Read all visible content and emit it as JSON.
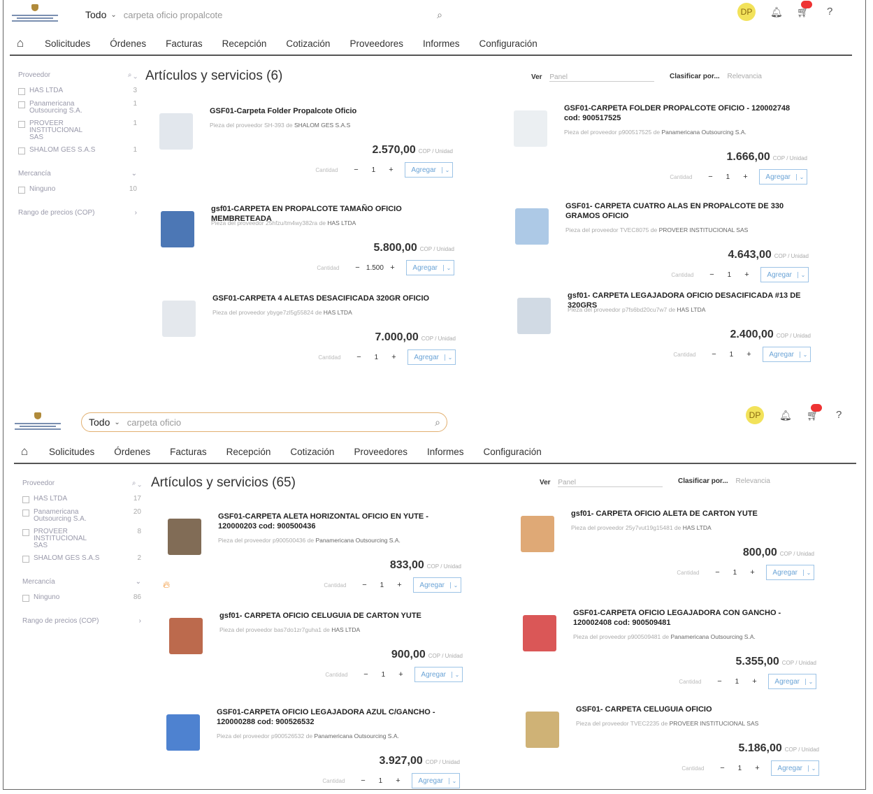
{
  "screens": [
    {
      "search": {
        "scope": "Todo",
        "query": "carpeta oficio propalcote"
      },
      "user": {
        "initials": "DP"
      },
      "nav": [
        "Solicitudes",
        "Órdenes",
        "Facturas",
        "Recepción",
        "Cotización",
        "Proveedores",
        "Informes",
        "Configuración"
      ],
      "results_title": "Artículos y servicios (6)",
      "view": {
        "label": "Ver",
        "value": "Panel"
      },
      "sort": {
        "label": "Clasificar por...",
        "value": "Relevancia"
      },
      "facets": {
        "provider_title": "Proveedor",
        "providers": [
          {
            "name": "HAS LTDA",
            "count": "3"
          },
          {
            "name": "Panamericana Outsourcing S.A.",
            "count": "1"
          },
          {
            "name": "PROVEER INSTITUCIONAL SAS",
            "count": "1"
          },
          {
            "name": "SHALOM GES S.A.S",
            "count": "1"
          }
        ],
        "merch_title": "Mercancía",
        "merch": [
          {
            "name": "Ninguno",
            "count": "10"
          }
        ],
        "price_title": "Rango de precios (COP)"
      },
      "products": [
        {
          "title": "GSF01-Carpeta Folder Propalcote Oficio",
          "sup_prefix": "Pieza del proveedor SH-393 de",
          "supplier": "SHALOM GES S.A.S",
          "price": "2.570,00",
          "unit": "COP / Unidad",
          "qty": "1"
        },
        {
          "title": "GSF01-CARPETA FOLDER PROPALCOTE OFICIO - 120002748 cod: 900517525",
          "sup_prefix": "Pieza del proveedor p900517525 de",
          "supplier": "Panamericana Outsourcing S.A.",
          "price": "1.666,00",
          "unit": "COP / Unidad",
          "qty": "1"
        },
        {
          "title": "gsf01-CARPETA EN PROPALCOTE TAMAÑO OFICIO MEMBRETEADA",
          "sup_prefix": "Pieza del proveedor 25hfzu/tm4wy382ra de",
          "supplier": "HAS LTDA",
          "price": "5.800,00",
          "unit": "COP / Unidad",
          "qty": "1.500"
        },
        {
          "title": "GSF01- CARPETA CUATRO ALAS EN PROPALCOTE DE 330 GRAMOS OFICIO",
          "sup_prefix": "Pieza del proveedor TVEC8075 de",
          "supplier": "PROVEER INSTITUCIONAL SAS",
          "price": "4.643,00",
          "unit": "COP / Unidad",
          "qty": "1"
        },
        {
          "title": "GSF01-CARPETA 4 ALETAS DESACIFICADA 320GR OFICIO",
          "sup_prefix": "Pieza del proveedor ybyge7zl5g55824 de",
          "supplier": "HAS LTDA",
          "price": "7.000,00",
          "unit": "COP / Unidad",
          "qty": "1"
        },
        {
          "title": "gsf01- CARPETA LEGAJADORA OFICIO DESACIFICADA #13 DE 320GRS",
          "sup_prefix": "Pieza del proveedor p7fs6bd20cu7w7 de",
          "supplier": "HAS LTDA",
          "price": "2.400,00",
          "unit": "COP / Unidad",
          "qty": "1"
        }
      ]
    },
    {
      "search": {
        "scope": "Todo",
        "query": "carpeta oficio"
      },
      "user": {
        "initials": "DP"
      },
      "nav": [
        "Solicitudes",
        "Órdenes",
        "Facturas",
        "Recepción",
        "Cotización",
        "Proveedores",
        "Informes",
        "Configuración"
      ],
      "results_title": "Artículos y servicios (65)",
      "view": {
        "label": "Ver",
        "value": "Panel"
      },
      "sort": {
        "label": "Clasificar por...",
        "value": "Relevancia"
      },
      "facets": {
        "provider_title": "Proveedor",
        "providers": [
          {
            "name": "HAS LTDA",
            "count": "17"
          },
          {
            "name": "Panamericana Outsourcing S.A.",
            "count": "20"
          },
          {
            "name": "PROVEER INSTITUCIONAL SAS",
            "count": "8"
          },
          {
            "name": "SHALOM GES S.A.S",
            "count": "2"
          }
        ],
        "merch_title": "Mercancía",
        "merch": [
          {
            "name": "Ninguno",
            "count": "86"
          }
        ],
        "price_title": "Rango de precios (COP)"
      },
      "products": [
        {
          "title": "GSF01-CARPETA ALETA HORIZONTAL OFICIO EN YUTE - 120000203 cod: 900500436",
          "sup_prefix": "Pieza del proveedor p900500436 de",
          "supplier": "Panamericana Outsourcing S.A.",
          "price": "833,00",
          "unit": "COP / Unidad",
          "qty": "1"
        },
        {
          "title": "gsf01- CARPETA OFICIO ALETA DE CARTON YUTE",
          "sup_prefix": "Pieza del proveedor 25y7vut19g15481 de",
          "supplier": "HAS LTDA",
          "price": "800,00",
          "unit": "COP / Unidad",
          "qty": "1"
        },
        {
          "title": "gsf01- CARPETA OFICIO CELUGUIA DE CARTON YUTE",
          "sup_prefix": "Pieza del proveedor bas7do1zr7guha1 de",
          "supplier": "HAS LTDA",
          "price": "900,00",
          "unit": "COP / Unidad",
          "qty": "1"
        },
        {
          "title": "GSF01-CARPETA OFICIO LEGAJADORA CON GANCHO - 120002408 cod: 900509481",
          "sup_prefix": "Pieza del proveedor p900509481 de",
          "supplier": "Panamericana Outsourcing S.A.",
          "price": "5.355,00",
          "unit": "COP / Unidad",
          "qty": "1"
        },
        {
          "title": "GSF01-CARPETA OFICIO LEGAJADORA AZUL C/GANCHO - 120000288 cod: 900526532",
          "sup_prefix": "Pieza del proveedor p900526532 de",
          "supplier": "Panamericana Outsourcing S.A.",
          "price": "3.927,00",
          "unit": "COP / Unidad",
          "qty": "1"
        },
        {
          "title": "GSF01- CARPETA CELUGUIA OFICIO",
          "sup_prefix": "Pieza del proveedor TVEC2235 de",
          "supplier": "PROVEER INSTITUCIONAL SAS",
          "price": "5.186,00",
          "unit": "COP / Unidad",
          "qty": "1"
        }
      ]
    }
  ],
  "labels": {
    "quantity": "Cantidad",
    "add": "Agregar",
    "help": "?"
  },
  "colors": {
    "accent": "#6aa3d6",
    "avatar": "#f2e25a",
    "badge": "#e33333",
    "search_border": "#e2b070"
  }
}
